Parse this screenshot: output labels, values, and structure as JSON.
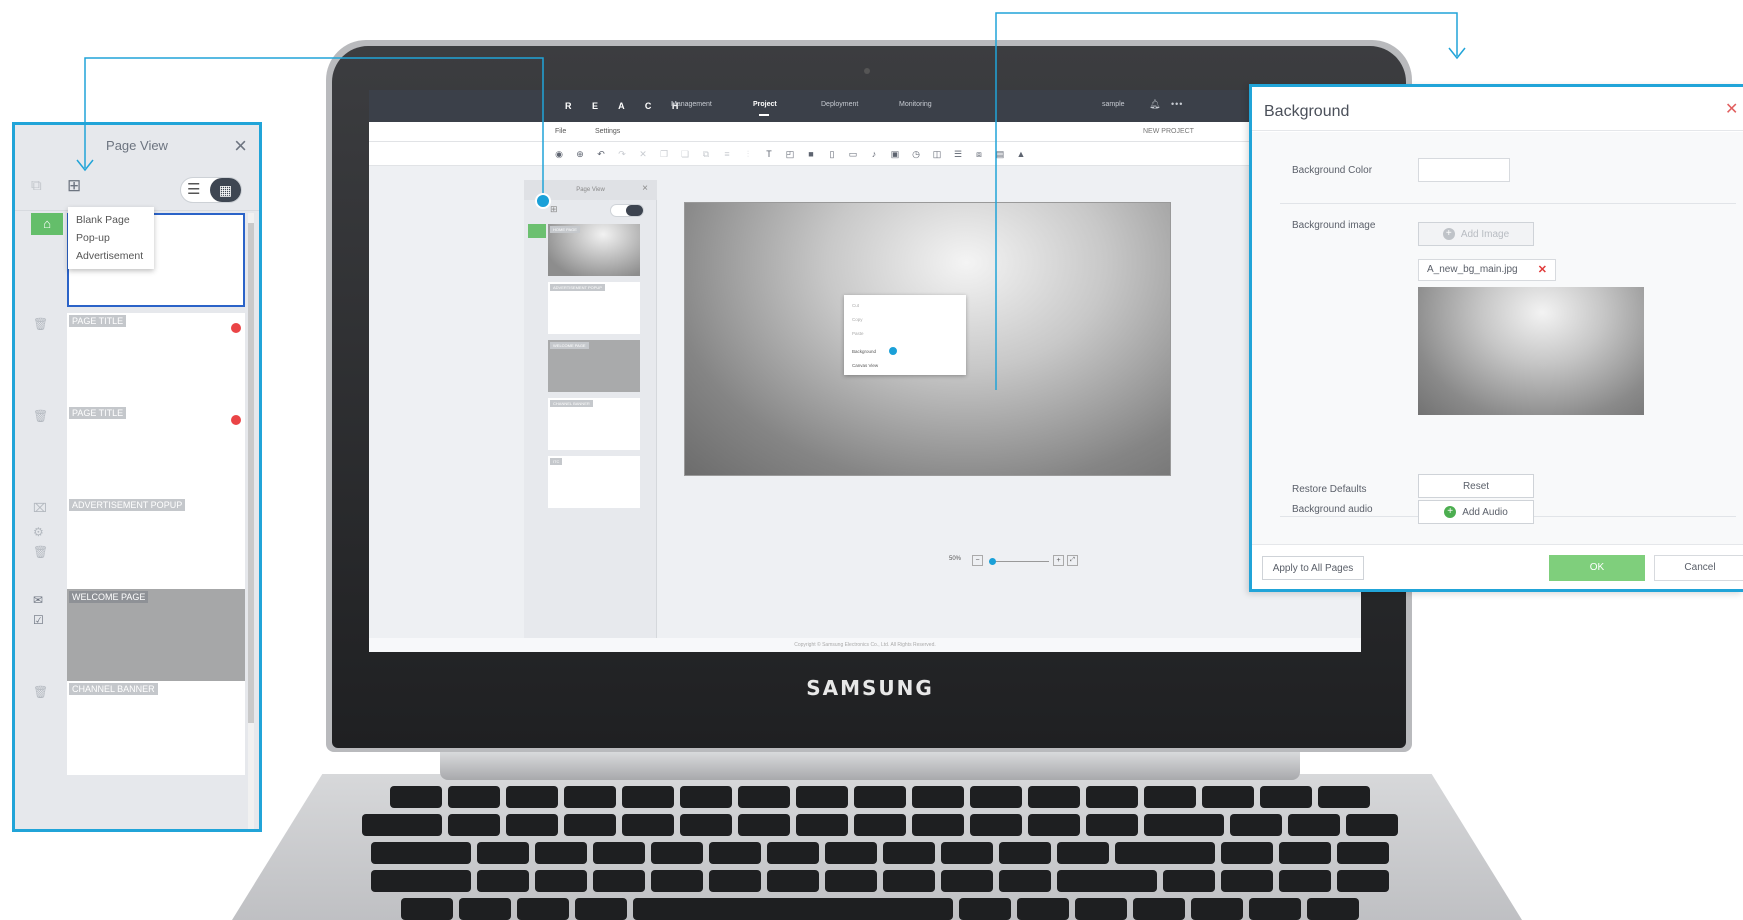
{
  "colors": {
    "accent": "#21a4d8",
    "ok_green": "#7fcf7c",
    "home_green": "#64be6a",
    "error_red": "#ea4446",
    "topbar": "#3b4049"
  },
  "laptop": {
    "brand": "SAMSUNG"
  },
  "app": {
    "logo": "R E A C H",
    "nav": [
      "Management",
      "Project",
      "Deployment",
      "Monitoring"
    ],
    "nav_active": "Project",
    "user": "sample",
    "menus": [
      "File",
      "Settings"
    ],
    "project_name": "NEW PROJECT",
    "mini_page_view_title": "Page View",
    "mini_pages": [
      "HOME PAGE",
      "ADVERTISEMENT POPUP",
      "WELCOME PAGE",
      "CHANNEL BANNER",
      "ITC"
    ],
    "context_menu": [
      "Cut",
      "Copy",
      "Paste",
      "Background",
      "Canvas View"
    ],
    "zoom_level": "50%",
    "copyright": "Copyright © Samsung Electronics Co., Ltd. All Rights Reserved."
  },
  "page_view": {
    "title": "Page View",
    "close_icon": "close-icon",
    "add_menu": [
      "Blank Page",
      "Pop-up",
      "Advertisement"
    ],
    "pages": [
      {
        "label": "",
        "type": "home"
      },
      {
        "label": "PAGE TITLE",
        "error": true
      },
      {
        "label": "PAGE TITLE",
        "error": true
      },
      {
        "label": "ADVERTISEMENT POPUP"
      },
      {
        "label": "WELCOME PAGE",
        "grey": true
      },
      {
        "label": "CHANNEL BANNER"
      }
    ]
  },
  "background_dialog": {
    "title": "Background",
    "color_label": "Background Color",
    "image_label": "Background image",
    "add_image": "Add Image",
    "file_name": "A_new_bg_main.jpg",
    "restore_label": "Restore Defaults",
    "reset": "Reset",
    "audio_label": "Background audio",
    "add_audio": "Add Audio",
    "apply_all": "Apply to All Pages",
    "ok": "OK",
    "cancel": "Cancel"
  }
}
